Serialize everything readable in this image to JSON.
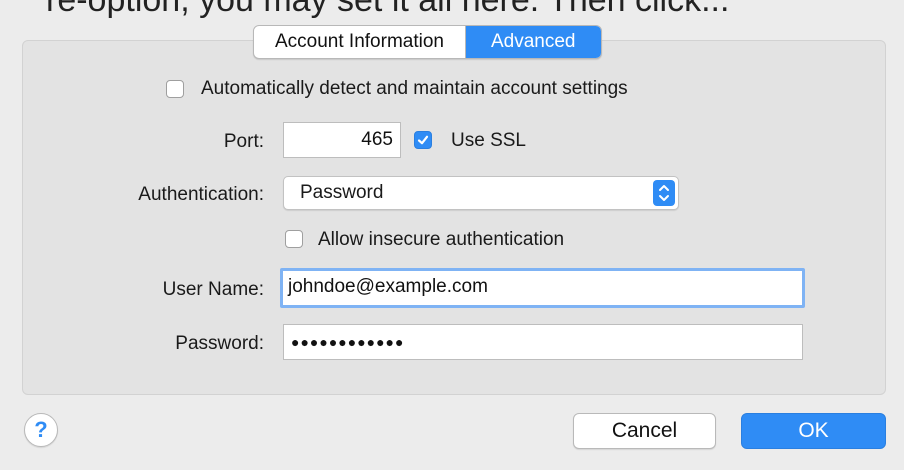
{
  "header": {
    "cut_text": "re-option, you may set it all here. Then click..."
  },
  "tabs": [
    {
      "label": "Account Information",
      "active": false
    },
    {
      "label": "Advanced",
      "active": true
    }
  ],
  "auto_detect": {
    "label": "Automatically detect and maintain account settings",
    "checked": false
  },
  "port": {
    "label": "Port:",
    "value": "465"
  },
  "use_ssl": {
    "label": "Use SSL",
    "checked": true
  },
  "authentication": {
    "label": "Authentication:",
    "selected": "Password"
  },
  "allow_insecure": {
    "label": "Allow insecure authentication",
    "checked": false
  },
  "user_name": {
    "label": "User Name:",
    "value": "johndoe@example.com"
  },
  "password": {
    "label": "Password:",
    "value": "●●●●●●●●●●●●"
  },
  "footer": {
    "help_label": "?",
    "cancel_label": "Cancel",
    "ok_label": "OK"
  },
  "colors": {
    "accent": "#2f8cf5",
    "panel": "#e3e3e3",
    "window": "#ececec"
  }
}
